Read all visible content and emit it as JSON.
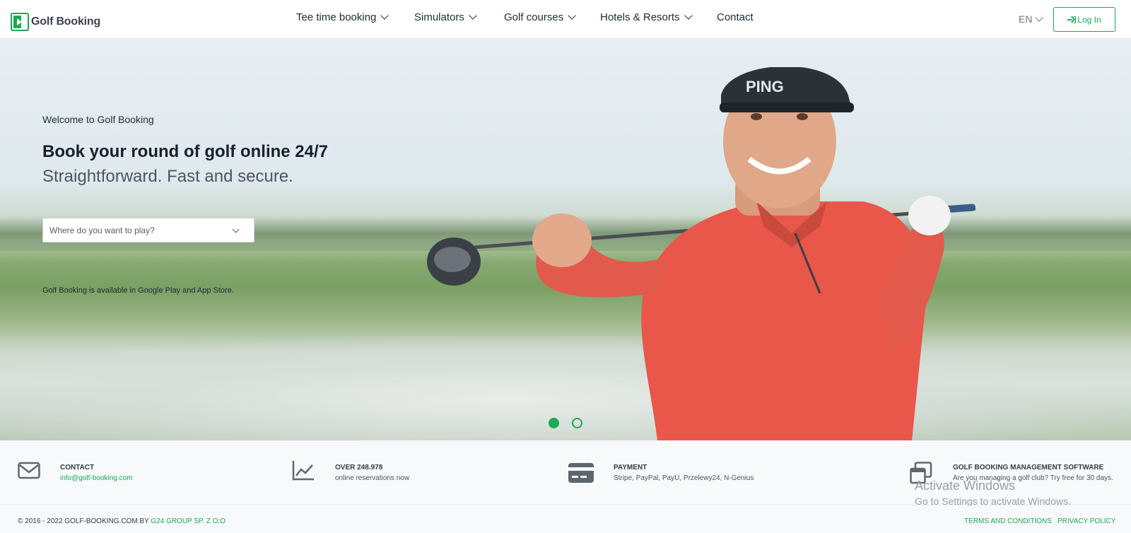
{
  "header": {
    "logo_text": "Golf Booking",
    "nav": [
      {
        "label": "Tee time booking",
        "dropdown": true
      },
      {
        "label": "Simulators",
        "dropdown": true
      },
      {
        "label": "Golf courses",
        "dropdown": true
      },
      {
        "label": "Hotels & Resorts",
        "dropdown": true
      },
      {
        "label": "Contact",
        "dropdown": false
      }
    ],
    "language": "EN",
    "login_label": "Log In"
  },
  "hero": {
    "welcome": "Welcome to Golf Booking",
    "headline": "Book your round of golf online 24/7",
    "subline": "Straightforward. Fast and secure.",
    "search_placeholder": "Where do you want to play?",
    "availability": "Golf Booking is available in Google Play and App Store.",
    "slides": {
      "count": 2,
      "active_index": 0
    }
  },
  "info": [
    {
      "icon": "envelope-icon",
      "title": "CONTACT",
      "text": "info@golf-booking.com"
    },
    {
      "icon": "chart-line-icon",
      "title": "OVER 248.978",
      "text": "online reservations now"
    },
    {
      "icon": "credit-card-icon",
      "title": "PAYMENT",
      "text": "Stripe, PayPal, PayU, Przelewy24, N-Genius"
    },
    {
      "icon": "windows-stack-icon",
      "title": "GOLF BOOKING MANAGEMENT SOFTWARE",
      "text": "Are you managing a golf club? Try free for 30 days."
    }
  ],
  "watermark": {
    "line1": "Activate Windows",
    "line2": "Go to Settings to activate Windows."
  },
  "footer": {
    "copyright_prefix": "© 2016 - 2022 GOLF-BOOKING.COM BY",
    "company": "G24 GROUP SP. Z O.O",
    "terms": "TERMS AND CONDITIONS",
    "privacy": "PRIVACY POLICY"
  },
  "colors": {
    "accent": "#1aaa55",
    "text_dark": "#1f2a37",
    "icon_gray": "#5d6670",
    "shirt_red": "#e8574a"
  }
}
